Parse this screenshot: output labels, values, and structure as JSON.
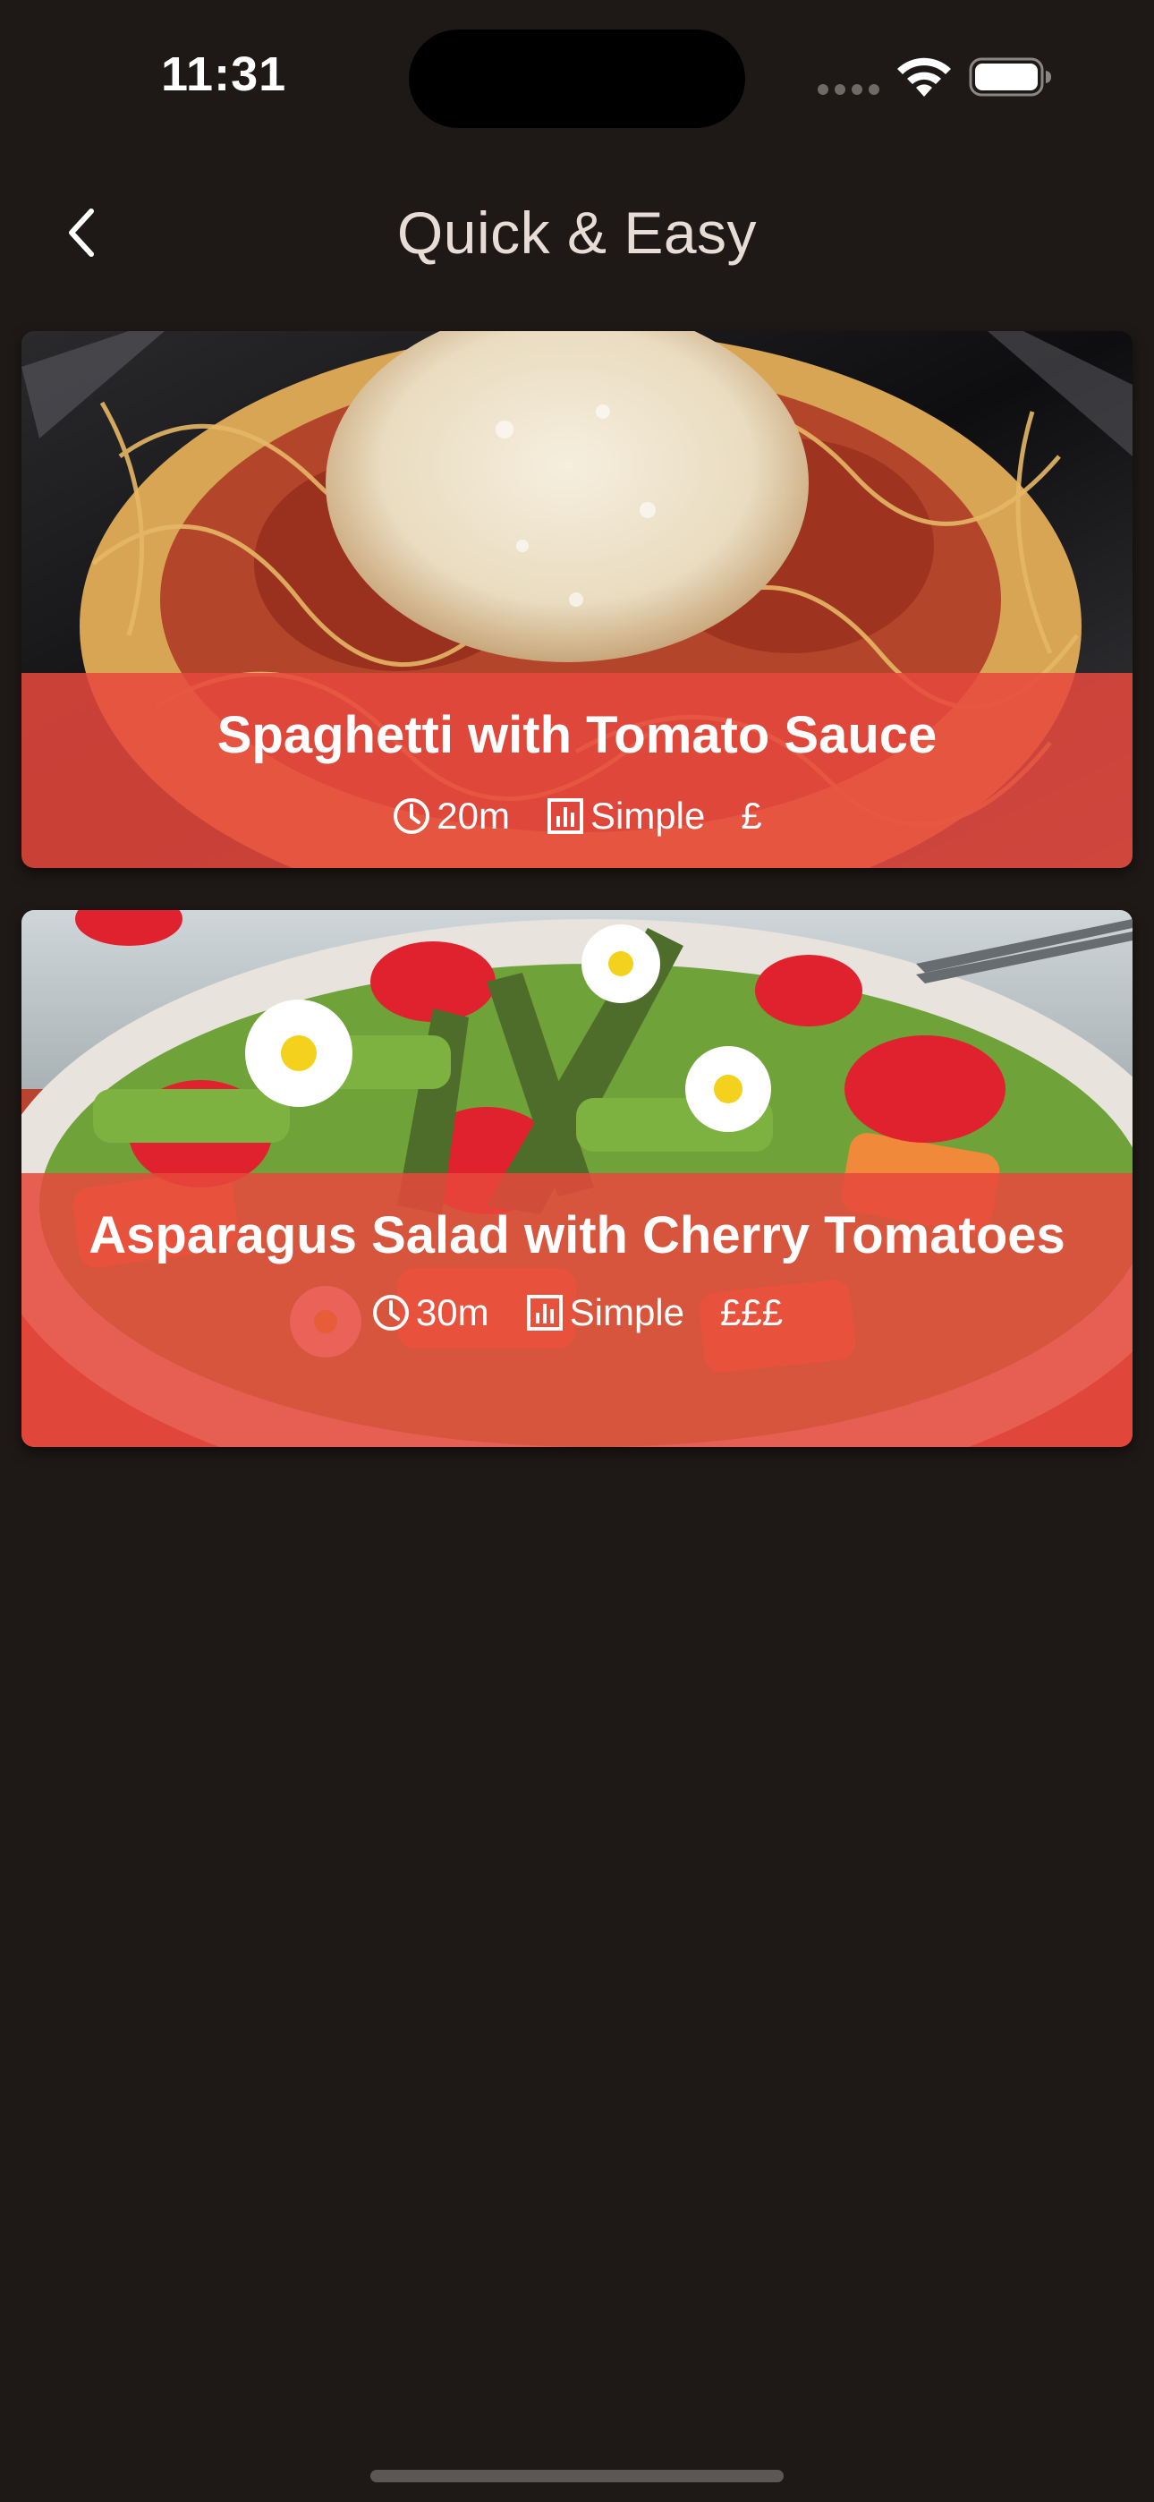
{
  "status_bar": {
    "time": "11:31",
    "icons": [
      "signal-dots-icon",
      "wifi-icon",
      "battery-icon"
    ]
  },
  "nav": {
    "title": "Quick & Easy",
    "back_icon": "chevron-left-icon"
  },
  "colors": {
    "background": "#1e1916",
    "card_overlay": "#e7483c",
    "text": "#ffffff",
    "title_text": "#e8dcd6"
  },
  "meals": [
    {
      "title": "Spaghetti with Tomato Sauce",
      "duration": "20m",
      "complexity": "Simple",
      "affordability": "£",
      "image": "spaghetti-photo"
    },
    {
      "title": "Asparagus Salad with Cherry Tomatoes",
      "duration": "30m",
      "complexity": "Simple",
      "affordability": "£££",
      "image": "asparagus-salad-photo"
    }
  ]
}
